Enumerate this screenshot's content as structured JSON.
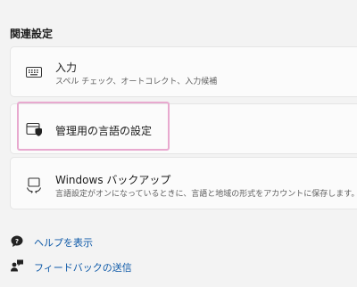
{
  "section": {
    "title": "関連設定"
  },
  "cards": {
    "input": {
      "title": "入力",
      "description": "スペル チェック、オートコレクト、入力候補",
      "icon": "keyboard-icon"
    },
    "admin_language": {
      "title": "管理用の言語の設定",
      "icon": "admin-shield-window-icon",
      "highlight_color": "#e8a9cf"
    },
    "backup": {
      "title": "Windows バックアップ",
      "description": "言語設定がオンになっているときに、言語と地域の形式をアカウントに保存します。",
      "icon": "backup-sync-icon"
    }
  },
  "links": {
    "help": {
      "label": "ヘルプを表示",
      "icon": "help-chat-icon"
    },
    "feedback": {
      "label": "フィードバックの送信",
      "icon": "feedback-person-icon"
    }
  },
  "colors": {
    "background": "#f3f3f3",
    "card": "#fbfbfb",
    "link": "#0f5aa8"
  }
}
